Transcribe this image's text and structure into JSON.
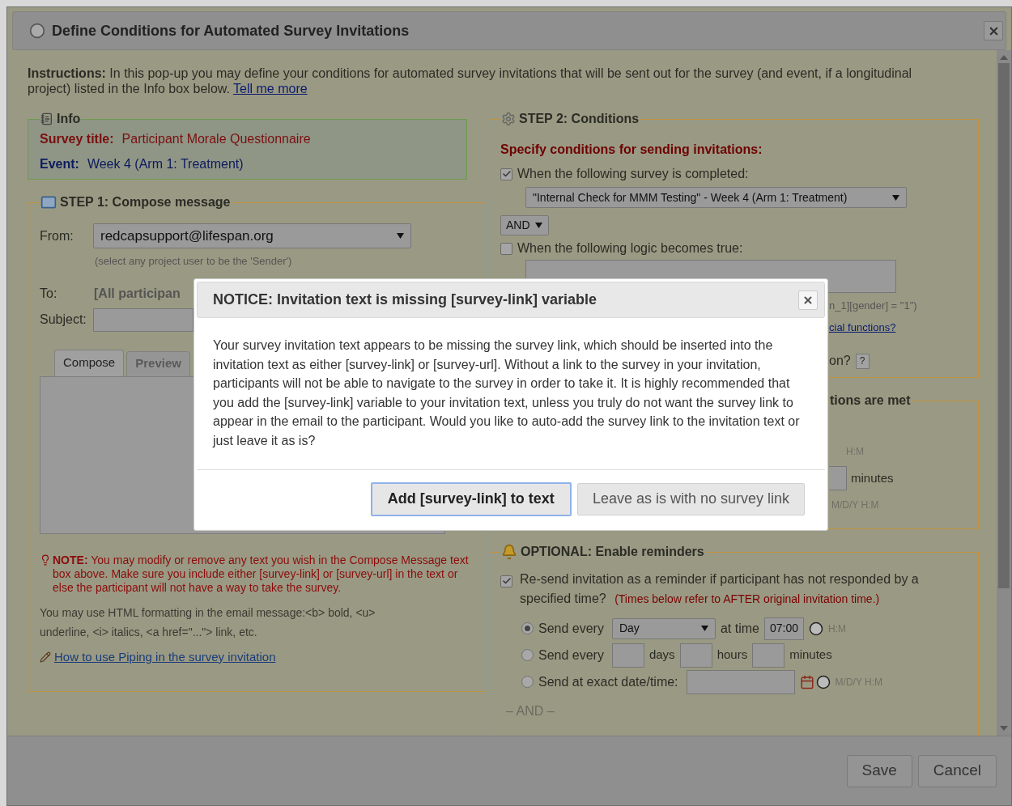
{
  "window": {
    "title": "Define Conditions for Automated Survey Invitations"
  },
  "instructions": {
    "text": "**Instructions:** In this pop-up you may define your conditions for automated survey invitations that will be sent out for the survey (and event, if a longitudinal project) listed in the Info box below.",
    "link": "Tell me more"
  },
  "info": {
    "legend": "Info",
    "survey_title_label": "Survey title:",
    "survey_title": "Participant Morale Questionnaire",
    "event_label": "Event:",
    "event": "Week 4 (Arm 1: Treatment)"
  },
  "step1": {
    "legend": "STEP 1: Compose message",
    "from_label": "From:",
    "from_value": "redcapsupport@lifespan.org",
    "from_hint": "(select any project user to be the 'Sender')",
    "to_label": "To:",
    "to_value": "[All participan",
    "subject_label": "Subject:",
    "tabs": [
      {
        "label": "Compose",
        "selected": true
      },
      {
        "label": "Preview",
        "selected": false
      }
    ],
    "note": "**NOTE:** You may modify or remove any text you wish in the Compose Message text box above. Make sure you include either [survey-link] or [survey-url] in the text or else the participant will not have a way to take the survey.",
    "html_hint": "You may use HTML formatting in the email message:<b> bold, <u> underline, <i> italics, <a href=\"...\"> link, etc.",
    "piping_link": "How to use Piping in the survey invitation"
  },
  "step2": {
    "legend": "STEP 2: Conditions",
    "heading": "Specify conditions for sending invitations:",
    "conditions": [
      {
        "label": "When the following survey is completed:",
        "checked": true
      },
      {
        "label": "When the following logic becomes true:",
        "checked": false
      }
    ],
    "survey_select": "\"Internal Check for MMM Testing\" - Week 4 (Arm 1: Treatment)",
    "operator": "AND",
    "logic_example": "n_1][gender] = \"1\")",
    "functions_link": "cial functions?",
    "question": "on?",
    "help": "?"
  },
  "when": {
    "legend": "tions are met",
    "time_format": "H:M",
    "minutes": "minutes",
    "datetime_format": "M/D/Y H:M"
  },
  "reminders": {
    "legend": "OPTIONAL: Enable reminders",
    "checked": true,
    "label": "Re-send invitation as a reminder if participant has not responded by a specified time?",
    "note": "(Times below refer to AFTER original invitation time.)",
    "options": [
      {
        "kind": "recurring",
        "selected": true,
        "label": "Send every",
        "select": "Day",
        "at_label": "at time",
        "time": "07:00",
        "format": "H:M"
      },
      {
        "kind": "interval",
        "selected": false,
        "label": "Send every",
        "units": [
          "days",
          "hours",
          "minutes"
        ]
      },
      {
        "kind": "exact",
        "selected": false,
        "label": "Send at exact date/time:",
        "format": "M/D/Y H:M"
      }
    ],
    "separator": "– AND –"
  },
  "footer": {
    "buttons": [
      "Save",
      "Cancel"
    ]
  },
  "notice": {
    "title": "NOTICE: Invitation text is missing [survey-link] variable",
    "body": "Your survey invitation text appears to be missing the survey link, which should be inserted into the invitation text as either [survey-link] or [survey-url]. Without a link to the survey in your invitation, participants will not be able to navigate to the survey in order to take it. It is highly recommended that you add the [survey-link] variable to your invitation text, unless you truly do not want the survey link to appear in the email to the participant. Would you like to auto-add the survey link to the invitation text or just leave it as is?",
    "buttons": [
      {
        "label": "Add [survey-link] to text",
        "primary": true
      },
      {
        "label": "Leave as is with no survey link",
        "primary": false
      }
    ]
  }
}
